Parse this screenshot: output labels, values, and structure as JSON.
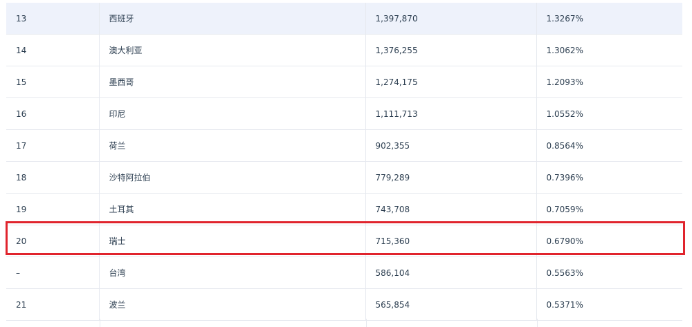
{
  "table": {
    "rows": [
      {
        "rank": "13",
        "country": "西班牙",
        "value": "1,397,870",
        "share": "1.3267%"
      },
      {
        "rank": "14",
        "country": "澳大利亚",
        "value": "1,376,255",
        "share": "1.3062%"
      },
      {
        "rank": "15",
        "country": "墨西哥",
        "value": "1,274,175",
        "share": "1.2093%"
      },
      {
        "rank": "16",
        "country": "印尼",
        "value": "1,111,713",
        "share": "1.0552%"
      },
      {
        "rank": "17",
        "country": "荷兰",
        "value": "902,355",
        "share": "0.8564%"
      },
      {
        "rank": "18",
        "country": "沙特阿拉伯",
        "value": "779,289",
        "share": "0.7396%"
      },
      {
        "rank": "19",
        "country": "土耳其",
        "value": "743,708",
        "share": "0.7059%"
      },
      {
        "rank": "20",
        "country": "瑞士",
        "value": "715,360",
        "share": "0.6790%"
      },
      {
        "rank": "–",
        "country": "台湾",
        "value": "586,104",
        "share": "0.5563%"
      },
      {
        "rank": "21",
        "country": "波兰",
        "value": "565,854",
        "share": "0.5371%"
      }
    ]
  },
  "highlight": {
    "color": "#e0242d",
    "row_rank": "20"
  }
}
